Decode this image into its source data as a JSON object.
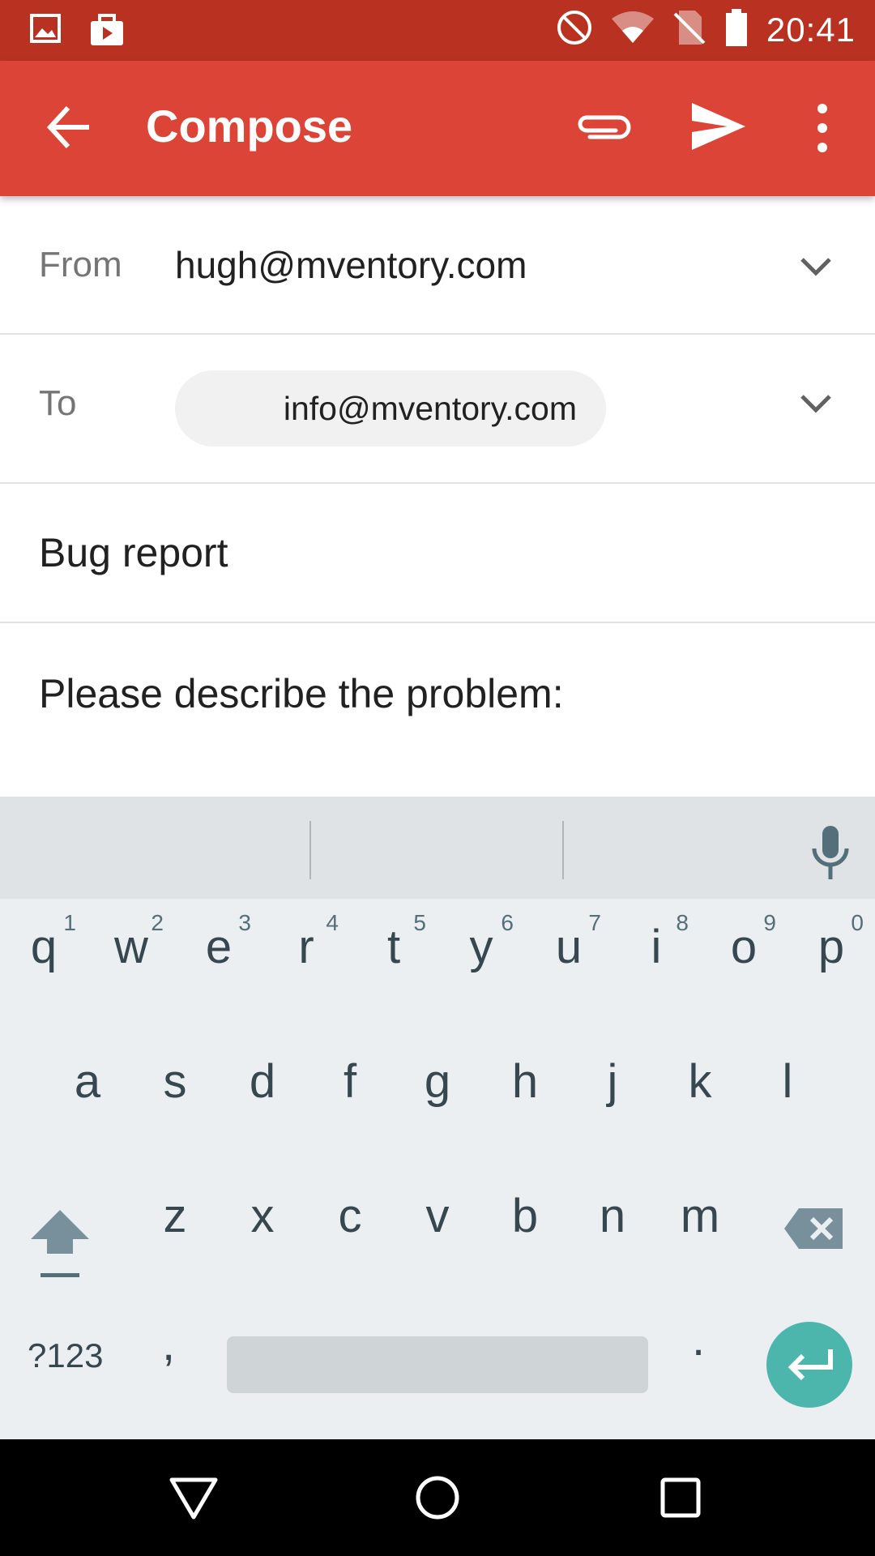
{
  "status_bar": {
    "time": "20:41",
    "icons": [
      "image-icon",
      "work-icon",
      "do-not-disturb-icon",
      "wifi-icon",
      "no-sim-icon",
      "battery-icon"
    ]
  },
  "app_bar": {
    "title": "Compose",
    "icons": [
      "back-arrow-icon",
      "paperclip-icon",
      "send-icon",
      "more-vert-icon"
    ],
    "background": "#db4437"
  },
  "compose": {
    "from_label": "From",
    "from_value": "hugh@mventory.com",
    "to_label": "To",
    "to_chip": "info@mventory.com",
    "subject": "Bug report",
    "body": "Please describe the problem:"
  },
  "keyboard": {
    "row1": [
      {
        "char": "q",
        "hint": "1"
      },
      {
        "char": "w",
        "hint": "2"
      },
      {
        "char": "e",
        "hint": "3"
      },
      {
        "char": "r",
        "hint": "4"
      },
      {
        "char": "t",
        "hint": "5"
      },
      {
        "char": "y",
        "hint": "6"
      },
      {
        "char": "u",
        "hint": "7"
      },
      {
        "char": "i",
        "hint": "8"
      },
      {
        "char": "o",
        "hint": "9"
      },
      {
        "char": "p",
        "hint": "0"
      }
    ],
    "row2": [
      "a",
      "s",
      "d",
      "f",
      "g",
      "h",
      "j",
      "k",
      "l"
    ],
    "row3": [
      "z",
      "x",
      "c",
      "v",
      "b",
      "n",
      "m"
    ],
    "symbols_label": "?123",
    "comma": ",",
    "period": ".",
    "accent": "#4db6ac"
  }
}
